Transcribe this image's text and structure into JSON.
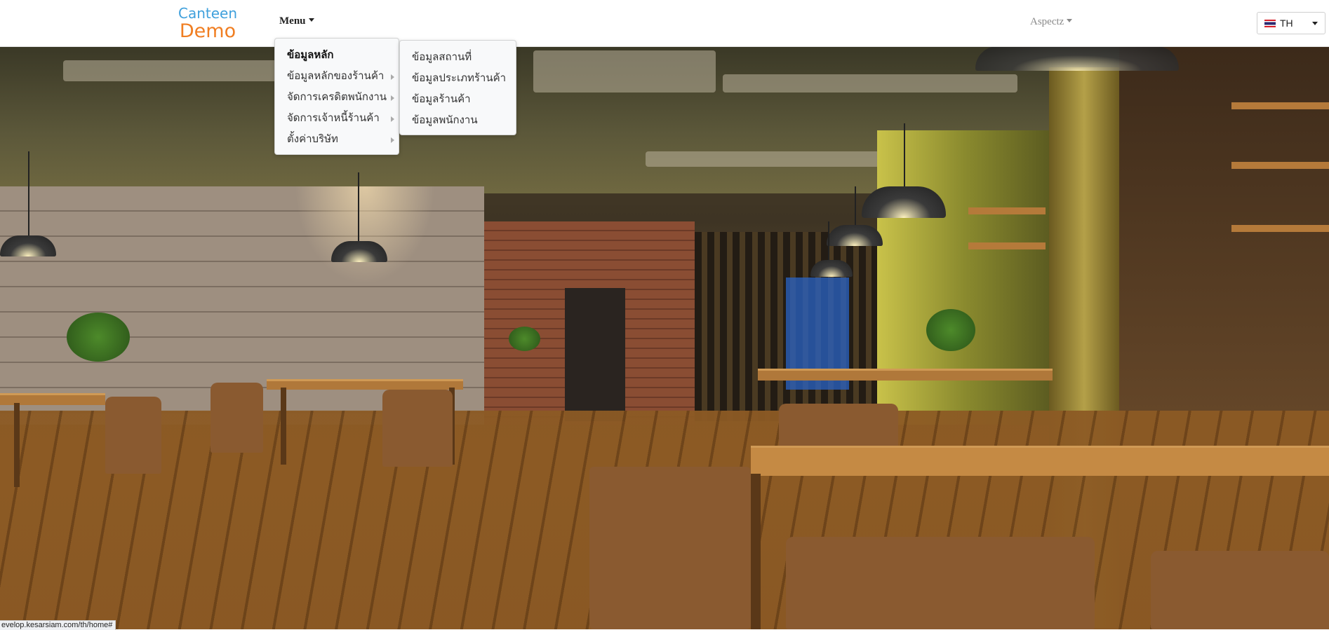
{
  "brand": {
    "line1": "Canteen",
    "line2": "Demo"
  },
  "nav": {
    "menu_label": "Menu",
    "user_label": "Aspectz"
  },
  "language": {
    "code": "TH",
    "flag": "flag-th-icon"
  },
  "main_menu": {
    "items": [
      {
        "label": "ข้อมูลหลัก",
        "active": true
      },
      {
        "label": "ข้อมูลหลักของร้านค้า"
      },
      {
        "label": "จัดการเครดิตพนักงาน"
      },
      {
        "label": "จัดการเจ้าหนี้ร้านค้า"
      },
      {
        "label": "ตั้งค่าบริษัท"
      }
    ]
  },
  "sub_menu": {
    "items": [
      {
        "label": "ข้อมูลสถานที่"
      },
      {
        "label": "ข้อมูลประเภทร้านค้า"
      },
      {
        "label": "ข้อมูลร้านค้า"
      },
      {
        "label": "ข้อมูลพนักงาน"
      }
    ]
  },
  "status_bar": {
    "url": "evelop.kesarsiam.com/th/home#"
  },
  "colors": {
    "brand_blue": "#3fa0dc",
    "brand_orange": "#f07e22",
    "dropdown_bg": "#f8f9fa"
  }
}
